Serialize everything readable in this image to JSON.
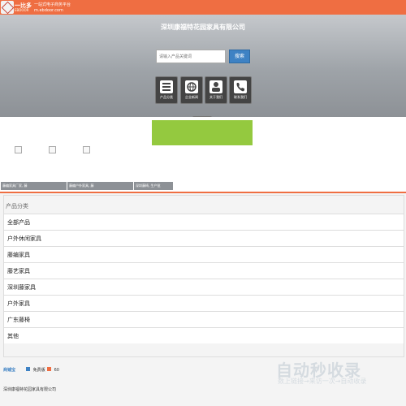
{
  "header": {
    "logo_text": "一比多",
    "logo_sub": "EBDOOR",
    "slogan": "一站式电子商务平台",
    "domain": "m.ebdoor.com"
  },
  "hero": {
    "company_title": "深圳康福特花园家具有限公司",
    "search_placeholder": "请输入产品关键词",
    "search_button": "搜索",
    "nav": [
      {
        "label": "产品分类",
        "icon": "list-icon"
      },
      {
        "label": "企业新闻",
        "icon": "globe-icon"
      },
      {
        "label": "关于我们",
        "icon": "user-icon"
      },
      {
        "label": "联系我们",
        "icon": "phone-icon"
      }
    ]
  },
  "banner": {
    "color": "#94c93f"
  },
  "tags": [
    "藤编家具厂家, 藤",
    "藤编户外家具, 藤",
    "深圳藤椅, 生产批"
  ],
  "categories": {
    "title": "产品分类",
    "items": [
      "全部产品",
      "户外休闲家具",
      "藤编家具",
      "藤艺家具",
      "深圳藤家具",
      "户外家具",
      "广东藤椅",
      "其他"
    ]
  },
  "footer": {
    "brand": "商铺宝",
    "free": "免费版",
    "badge": "60",
    "company": "深圳康福特花园家具有限公司"
  },
  "watermark": {
    "text": "自动秒收录",
    "sub": "数上链接→来访一次→自动收录"
  },
  "colors": {
    "accent": "#ef6e42",
    "button": "#3e82c4",
    "hero": "#9ea3a8"
  }
}
